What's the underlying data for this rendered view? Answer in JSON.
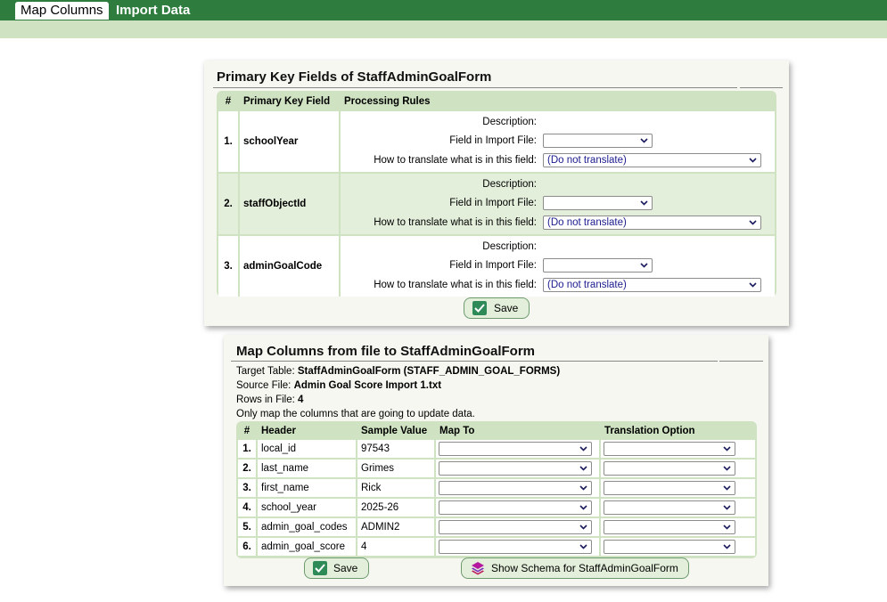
{
  "tabs": [
    {
      "label": "Map Columns",
      "active": true
    },
    {
      "label": "Import Data",
      "active": false
    }
  ],
  "primary_key": {
    "title": "Primary Key Fields of StaffAdminGoalForm",
    "headers": [
      "#",
      "Primary Key Field",
      "Processing Rules"
    ],
    "description_label": "Description:",
    "field_label": "Field in Import File:",
    "translate_label": "How to translate what is in this field:",
    "translate_default": "(Do not translate)",
    "rows": [
      {
        "num": "1.",
        "field": "schoolYear"
      },
      {
        "num": "2.",
        "field": "staffObjectId"
      },
      {
        "num": "3.",
        "field": "adminGoalCode"
      }
    ],
    "save_label": "Save"
  },
  "map_columns": {
    "title": "Map Columns from file to StaffAdminGoalForm",
    "target_label": "Target Table:",
    "target_value": "StaffAdminGoalForm (STAFF_ADMIN_GOAL_FORMS)",
    "source_label": "Source File:",
    "source_value": "Admin Goal Score Import 1.txt",
    "rows_label": "Rows in File:",
    "rows_value": "4",
    "note": "Only map the columns that are going to update data.",
    "headers": [
      "#",
      "Header",
      "Sample Value",
      "Map To",
      "Translation Option"
    ],
    "rows": [
      {
        "num": "1.",
        "header": "local_id",
        "sample": "97543"
      },
      {
        "num": "2.",
        "header": "last_name",
        "sample": "Grimes"
      },
      {
        "num": "3.",
        "header": "first_name",
        "sample": "Rick"
      },
      {
        "num": "4.",
        "header": "school_year",
        "sample": "2025-26"
      },
      {
        "num": "5.",
        "header": "admin_goal_codes",
        "sample": "ADMIN2"
      },
      {
        "num": "6.",
        "header": "admin_goal_score",
        "sample": "4"
      }
    ],
    "save_label": "Save",
    "schema_label": "Show Schema for StaffAdminGoalForm"
  },
  "colors": {
    "topbar": "#2e7d3e",
    "subbar": "#cfe3c2",
    "table_frame": "#cfe3c2",
    "row_alt": "#e3efdb"
  },
  "icons": {
    "save": "check-box-icon",
    "schema": "layers-icon",
    "dropdown": "chevron-down-icon"
  }
}
